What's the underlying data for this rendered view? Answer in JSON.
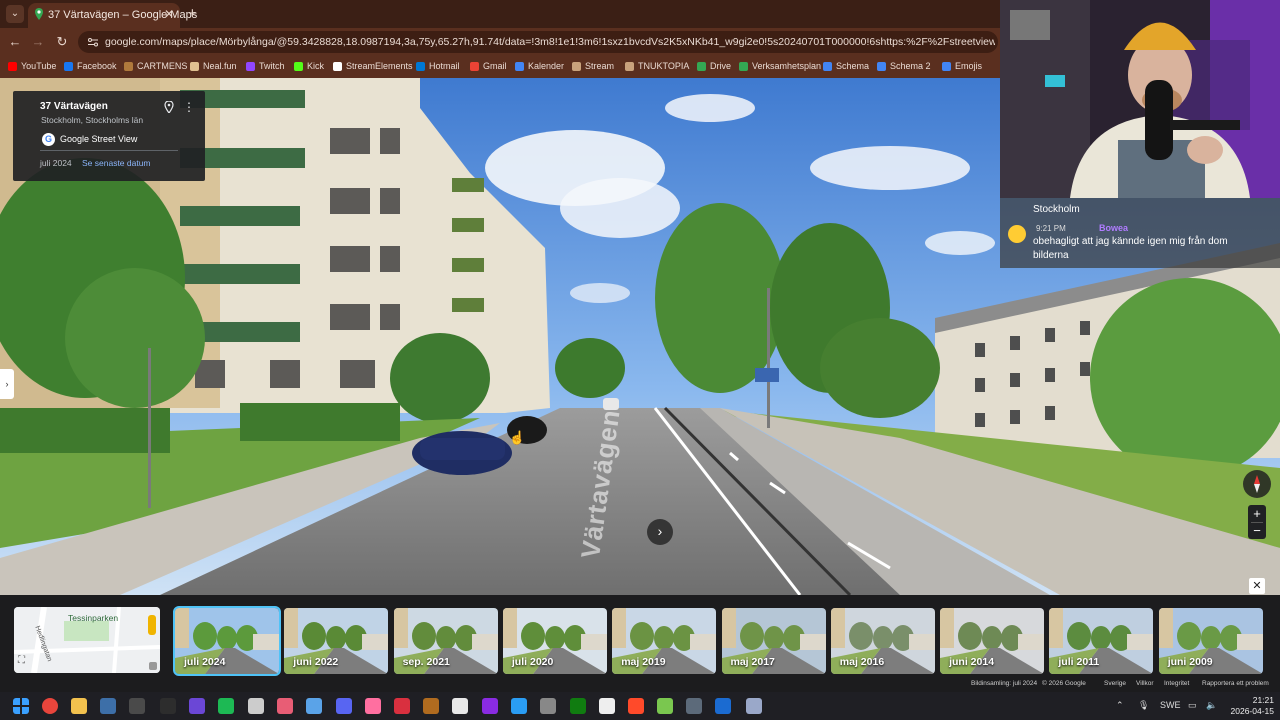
{
  "browser": {
    "tab_title": "37 Värtavägen – Google Maps",
    "url": "google.com/maps/place/Mörbylånga/@59.3428828,18.0987194,3a,75y,65.27h,91.74t/data=!3m8!1e1!3m6!1sxz1bvcdVs2K5xNKb41_w9gi2e0!5s20240701T000000!6shttps:%2F%2Fstreetviewpixels-pa.googleapis.com...",
    "new_tab": "+",
    "bookmarks": [
      {
        "label": "YouTube",
        "color": "#ff0000"
      },
      {
        "label": "Facebook",
        "color": "#1877f2"
      },
      {
        "label": "CARTMENS",
        "color": "#b07a3c"
      },
      {
        "label": "Neal.fun",
        "color": "#e0c090"
      },
      {
        "label": "Twitch",
        "color": "#9146ff"
      },
      {
        "label": "Kick",
        "color": "#53fc18"
      },
      {
        "label": "StreamElements",
        "color": "#ffffff"
      },
      {
        "label": "Hotmail",
        "color": "#0078d4"
      },
      {
        "label": "Gmail",
        "color": "#ea4335"
      },
      {
        "label": "Kalender",
        "color": "#4285f4"
      },
      {
        "label": "Stream",
        "color": "#c9a27c"
      },
      {
        "label": "TNUKTOPIA",
        "color": "#c9a27c"
      },
      {
        "label": "Drive",
        "color": "#34a853"
      },
      {
        "label": "Verksamhetsplan",
        "color": "#34a853"
      },
      {
        "label": "Schema",
        "color": "#4285f4"
      },
      {
        "label": "Schema 2",
        "color": "#4285f4"
      },
      {
        "label": "Emojis",
        "color": "#4285f4"
      }
    ]
  },
  "info_card": {
    "address": "37 Värtavägen",
    "city": "Stockholm, Stockholms län",
    "provider": "Google Street View",
    "date": "juli 2024",
    "latest_link": "Se senaste datum"
  },
  "scene": {
    "road_label": "Värtavägen",
    "nav_arrow": "›",
    "close": "✕",
    "zoom_in": "+",
    "zoom_out": "−"
  },
  "chat": {
    "location": "Stockholm",
    "time": "9:21 PM",
    "username": "Bowea",
    "message": "obehagligt att jag kännde igen mig från dom bilderna"
  },
  "timeline": {
    "map_label": "Tessinparken",
    "street_label": "Hedlingatan",
    "thumbs": [
      "juli 2024",
      "juni 2022",
      "sep. 2021",
      "juli 2020",
      "maj 2019",
      "maj 2017",
      "maj 2016",
      "juni 2014",
      "juli 2011",
      "juni 2009"
    ],
    "footer": [
      "Bildinsamling: juli 2024",
      "© 2026 Google",
      "Sverige",
      "Villkor",
      "Integritet",
      "Rapportera ett problem"
    ]
  },
  "taskbar": {
    "lang": "SWE",
    "time": "21:21",
    "date": "2026-04-15"
  }
}
